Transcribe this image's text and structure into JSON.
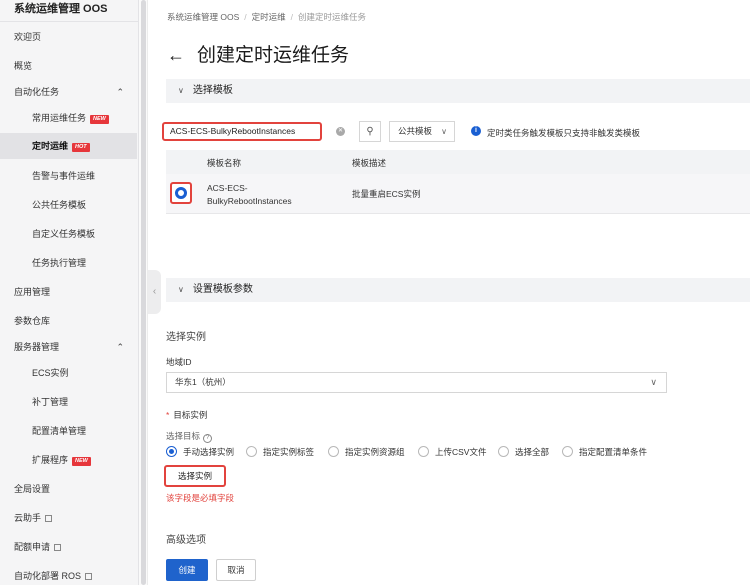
{
  "sidebar": {
    "title": "系统运维管理 OOS",
    "items": [
      {
        "label": "欢迎页",
        "badge": "",
        "chevron": ""
      },
      {
        "label": "概览",
        "badge": "",
        "chevron": ""
      },
      {
        "label": "自动化任务",
        "badge": "",
        "chevron": "^"
      },
      {
        "label": "常用运维任务",
        "badge": "NEW",
        "chevron": ""
      },
      {
        "label": "定时运维",
        "badge": "HOT",
        "chevron": ""
      },
      {
        "label": "告警与事件运维",
        "badge": "",
        "chevron": ""
      },
      {
        "label": "公共任务模板",
        "badge": "",
        "chevron": ""
      },
      {
        "label": "自定义任务模板",
        "badge": "",
        "chevron": ""
      },
      {
        "label": "任务执行管理",
        "badge": "",
        "chevron": ""
      },
      {
        "label": "应用管理",
        "badge": "",
        "chevron": ""
      },
      {
        "label": "参数仓库",
        "badge": "",
        "chevron": ""
      },
      {
        "label": "服务器管理",
        "badge": "",
        "chevron": "^"
      },
      {
        "label": "ECS实例",
        "badge": "",
        "chevron": ""
      },
      {
        "label": "补丁管理",
        "badge": "",
        "chevron": ""
      },
      {
        "label": "配置清单管理",
        "badge": "",
        "chevron": ""
      },
      {
        "label": "扩展程序",
        "badge": "NEW",
        "chevron": ""
      },
      {
        "label": "全局设置",
        "badge": "",
        "chevron": ""
      },
      {
        "label": "云助手",
        "badge": "",
        "chevron": ""
      },
      {
        "label": "配额申请",
        "badge": "",
        "chevron": ""
      },
      {
        "label": "自动化部署 ROS",
        "badge": "",
        "chevron": ""
      }
    ]
  },
  "breadcrumb": [
    "系统运维管理 OOS",
    "定时运维",
    "创建定时运维任务"
  ],
  "page_title": "创建定时运维任务",
  "section_template": {
    "title": "选择模板",
    "search_value": "ACS-ECS-BulkyRebootInstances",
    "template_select": "公共模板",
    "info_text": "定时类任务触发模板只支持非触发类模板",
    "table": {
      "headers": [
        "模板名称",
        "模板描述"
      ],
      "rows": [
        {
          "name": "ACS-ECS-BulkyRebootInstances",
          "desc": "批量重启ECS实例",
          "selected": true
        }
      ]
    }
  },
  "section_params": {
    "title": "设置模板参数",
    "select_instance_title": "选择实例",
    "region_label": "地域ID",
    "region_value": "华东1（杭州）",
    "target_label": "目标实例",
    "select_target_label": "选择目标",
    "options": [
      "手动选择实例",
      "指定实例标签",
      "指定实例资源组",
      "上传CSV文件",
      "选择全部",
      "指定配置清单条件"
    ],
    "selected_option_index": 0,
    "select_instance_button": "选择实例",
    "error_text": "该字段是必填字段",
    "advanced_title": "高级选项"
  },
  "footer": {
    "create": "创建",
    "cancel": "取消"
  },
  "colors": {
    "primary": "#1f63cc",
    "error_highlight": "#e2433d",
    "badge": "#e6363b"
  }
}
